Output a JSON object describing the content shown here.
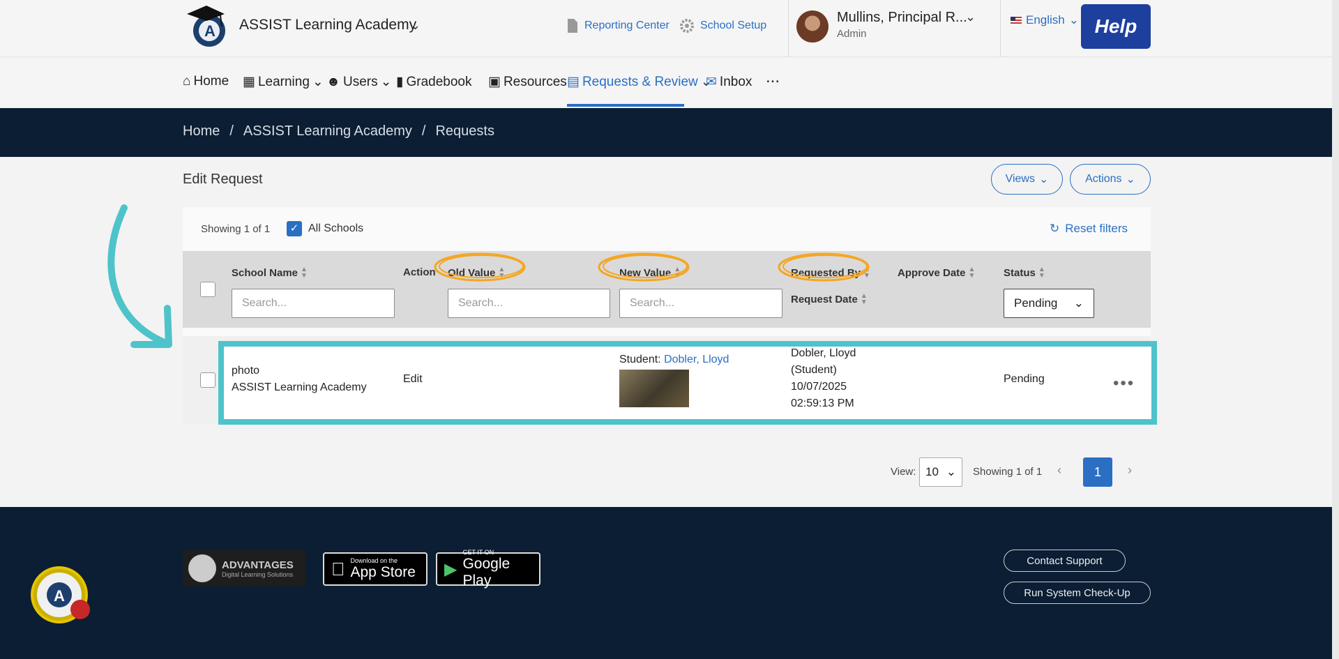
{
  "header": {
    "school_name": "ASSIST Learning Academy",
    "reporting_center": "Reporting Center",
    "school_setup": "School Setup",
    "user_name": "Mullins, Principal R...",
    "user_role": "Admin",
    "language": "English",
    "help": "Help"
  },
  "nav": {
    "home": "Home",
    "learning": "Learning",
    "users": "Users",
    "gradebook": "Gradebook",
    "resources": "Resources",
    "requests": "Requests & Review",
    "inbox": "Inbox",
    "more": "..."
  },
  "breadcrumb": [
    "Home",
    "/",
    "ASSIST Learning Academy",
    "/",
    "Requests"
  ],
  "page": {
    "title": "Edit Request",
    "views": "Views",
    "actions": "Actions",
    "showing": "Showing 1 of 1",
    "all_schools": "All Schools",
    "reset_filters": "Reset filters"
  },
  "table": {
    "columns": {
      "school_name": "School Name",
      "action": "Action",
      "old_value": "Old Value",
      "new_value": "New Value",
      "requested_by": "Requested By",
      "request_date": "Request Date",
      "approve_date": "Approve Date",
      "status": "Status"
    },
    "search_placeholder": "Search...",
    "status_filter": "Pending",
    "row": {
      "type": "photo",
      "school": "ASSIST Learning Academy",
      "action": "Edit",
      "new_value_label": "Student:",
      "new_value_student": "Dobler, Lloyd",
      "requested_by": "Dobler, Lloyd",
      "requested_role": "(Student)",
      "request_date": "10/07/2025",
      "request_time": "02:59:13 PM",
      "status": "Pending"
    }
  },
  "pagination": {
    "view_label": "View:",
    "page_size": "10",
    "showing": "Showing 1 of 1",
    "current_page": "1"
  },
  "footer": {
    "advantages_title": "ADVANTAGES",
    "advantages_sub": "Digital Learning Solutions",
    "appstore_small": "Download on the",
    "appstore_big": "App Store",
    "googleplay_small": "GET IT ON",
    "googleplay_big": "Google Play",
    "contact_support": "Contact Support",
    "system_checkup": "Run System Check-Up"
  },
  "colors": {
    "accent": "#2a6fc4",
    "band": "#0b1e33",
    "highlight": "#4ec3c9",
    "annotation": "#f5a623"
  }
}
